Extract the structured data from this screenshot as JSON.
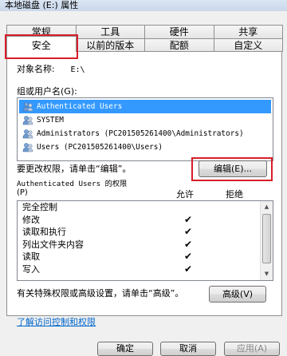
{
  "window": {
    "title": "本地磁盘 (E:) 属性"
  },
  "tabs": {
    "row1": [
      "常规",
      "工具",
      "硬件",
      "共享"
    ],
    "row2": [
      "安全",
      "以前的版本",
      "配额",
      "自定义"
    ],
    "active": "安全"
  },
  "object": {
    "label": "对象名称:",
    "value": "E:\\"
  },
  "groups": {
    "label": "组或用户名(G):",
    "items": [
      {
        "name": "Authenticated Users",
        "selected": true,
        "icon": "users-icon"
      },
      {
        "name": "SYSTEM",
        "selected": false,
        "icon": "users-icon"
      },
      {
        "name": "Administrators (PC201505261400\\Administrators)",
        "selected": false,
        "icon": "users-icon"
      },
      {
        "name": "Users (PC201505261400\\Users)",
        "selected": false,
        "icon": "users-icon"
      }
    ]
  },
  "change_perm": {
    "text": "要更改权限，请单击“编辑”。",
    "edit_button": "编辑(E)..."
  },
  "permissions": {
    "title": "Authenticated Users 的权限",
    "p_label": "(P)",
    "allow": "允许",
    "deny": "拒绝",
    "rows": [
      {
        "name": "完全控制",
        "allow": ""
      },
      {
        "name": "修改",
        "allow": "✔"
      },
      {
        "name": "读取和执行",
        "allow": "✔"
      },
      {
        "name": "列出文件夹内容",
        "allow": "✔"
      },
      {
        "name": "读取",
        "allow": "✔"
      },
      {
        "name": "写入",
        "allow": "✔"
      }
    ]
  },
  "special": {
    "text": "有关特殊权限或高级设置，请单击“高级”。",
    "advanced_button": "高级(V)"
  },
  "link": "了解访问控制和权限",
  "buttons": {
    "ok": "确定",
    "cancel": "取消",
    "apply": "应用(A)"
  },
  "colors": {
    "highlight": "#d81e2a",
    "selection": "#3399ff",
    "link": "#0066cc"
  }
}
